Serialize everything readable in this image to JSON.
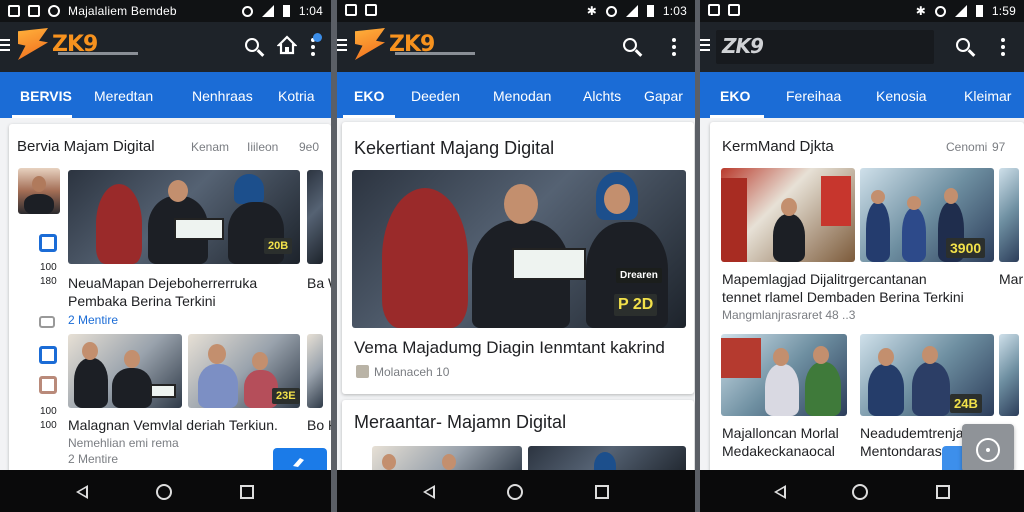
{
  "status": {
    "p1_title": "Majalaliem Bemdeb",
    "p1_time": "1:04",
    "p2_time": "1:03",
    "p3_time": "1:59"
  },
  "brand": {
    "logo_text": "ZK9"
  },
  "p1": {
    "tabs": [
      "BERVIS",
      "Meredtan",
      "Nenhraas",
      "Kotria"
    ],
    "section_title": "Bervia Majam Digital",
    "section_meta": [
      "Kenam",
      "Iiileon",
      "9e0"
    ],
    "side_numbers": [
      "100",
      "180",
      "100",
      "100"
    ],
    "tag1": "20B",
    "tag2": "23E",
    "article1_headline_1": "NeuaMapan Dejeboherrerruka",
    "article1_headline_2": "Pembaka Berina Terkini",
    "article1_sub": "2 Mentire",
    "article2_headline": "Malagnan Vemvlal deriah Terkiun.",
    "article2_sub1": "Nemehlian emi rema",
    "article2_sub2": "2 Mentire",
    "right_peek1": "Ba W",
    "right_peek2": "Bo K"
  },
  "p2": {
    "tabs": [
      "EKO",
      "Deeden",
      "Menodan",
      "Alchts",
      "Gapar"
    ],
    "section_title": "Kekertiant Majang Digital",
    "tag_small": "Drearen",
    "tag_big": "P 2D",
    "headline": "Vema Majadumg Diagin Ienmtant kakrind",
    "meta": "Molanaceh 10",
    "section2_title": "Meraantar- Majamn Digital"
  },
  "p3": {
    "search_value": "ZK9",
    "tabs": [
      "EKO",
      "Fereihaa",
      "Kenosia",
      "Kleimar"
    ],
    "section_title": "KermMand Djkta",
    "section_meta": [
      "Cenomi",
      "97"
    ],
    "tag1": "3900",
    "tag2": "24B",
    "article1_headline_1": "Mapemlagjad Dijalitrgercantanan",
    "article1_headline_2": "tennet rlamel Dembaden Berina Terkini",
    "article1_sub": "Mangmlanjrasraret 48 ..3",
    "article2_headline_1": "Majalloncan Morlal",
    "article2_headline_2": "Medakeckanaocal",
    "article3_headline_1": "Neadudemtrenja",
    "article3_headline_2": "Mentondaras",
    "right_peek": "Mar"
  },
  "colors": {
    "tab_blue": "#1b6cd6",
    "appbar": "#1e2329",
    "logo_orange": "#f7921e"
  }
}
